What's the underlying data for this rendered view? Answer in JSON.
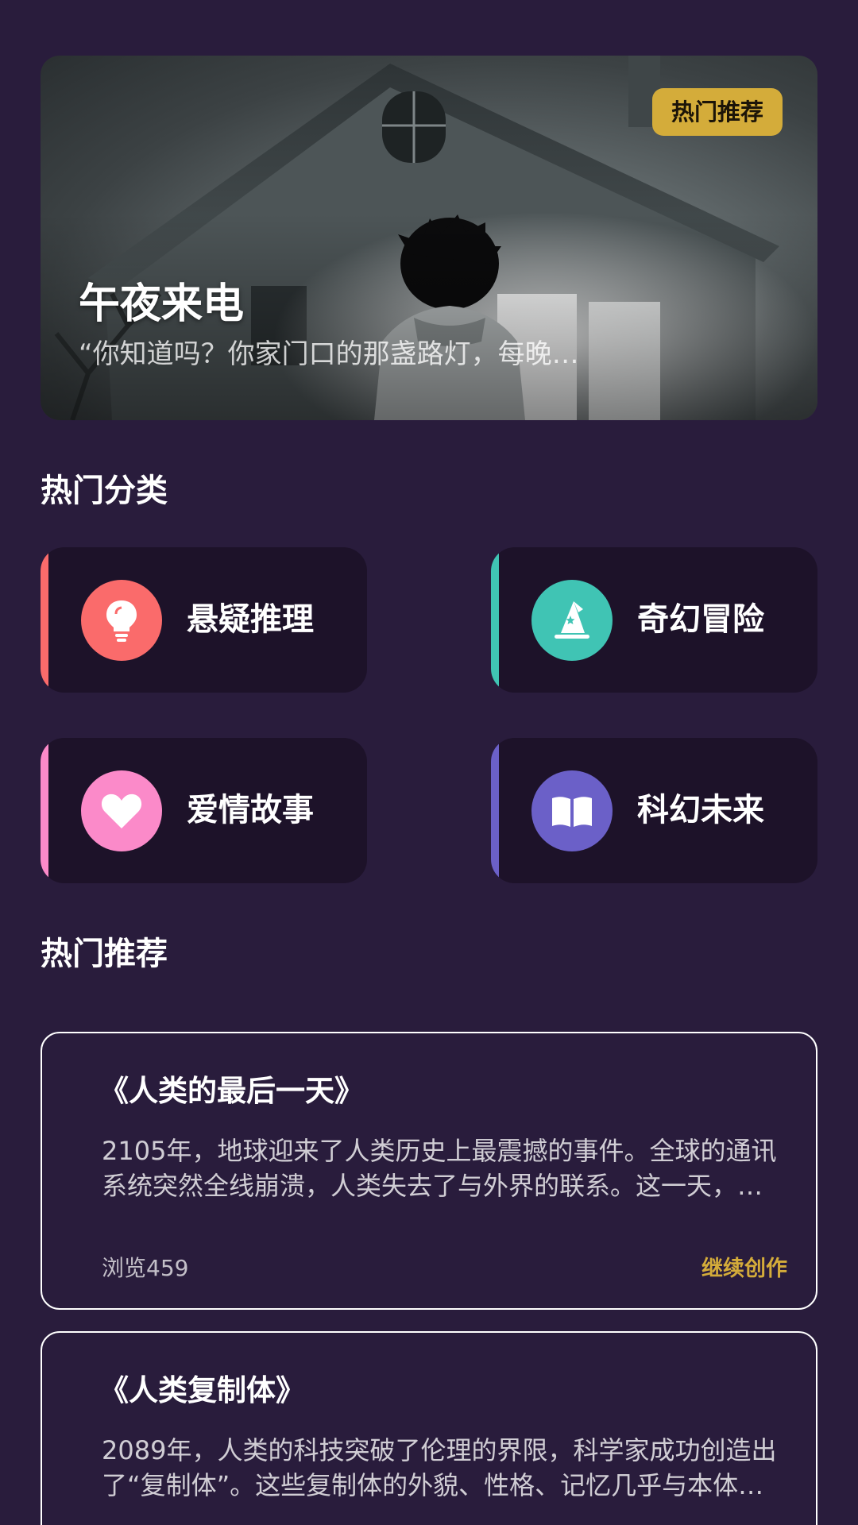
{
  "hero": {
    "badge": "热门推荐",
    "title": "午夜来电",
    "excerpt": "“你知道吗？你家门口的那盏路灯，每晚…"
  },
  "categories_section": {
    "title": "热门分类",
    "items": [
      {
        "label": "悬疑推理",
        "icon": "lightbulb-icon",
        "color": "#fa6b6b"
      },
      {
        "label": "奇幻冒险",
        "icon": "wizard-hat-icon",
        "color": "#40c4b4"
      },
      {
        "label": "爱情故事",
        "icon": "heart-icon",
        "color": "#fb8ac9"
      },
      {
        "label": "科幻未来",
        "icon": "book-open-icon",
        "color": "#6b60c8"
      }
    ]
  },
  "recommend_section": {
    "title": "热门推荐",
    "items": [
      {
        "title": "《人类的最后一天》",
        "description": "2105年，地球迎来了人类历史上最震撼的事件。全球的通讯系统突然全线崩溃，人类失去了与外界的联系。这一天，人类的命运将彻底改变。",
        "views": "浏览459",
        "action": "继续创作"
      },
      {
        "title": "《人类复制体》",
        "description": "2089年，人类的科技突破了伦理的界限，科学家成功创造出了“复制体”。这些复制体的外貌、性格、记忆几乎与本体完全一致。",
        "views": "",
        "action": ""
      }
    ]
  },
  "colors": {
    "background": "#291c3c",
    "card": "#1d1229",
    "gold": "#d4ac3a"
  }
}
